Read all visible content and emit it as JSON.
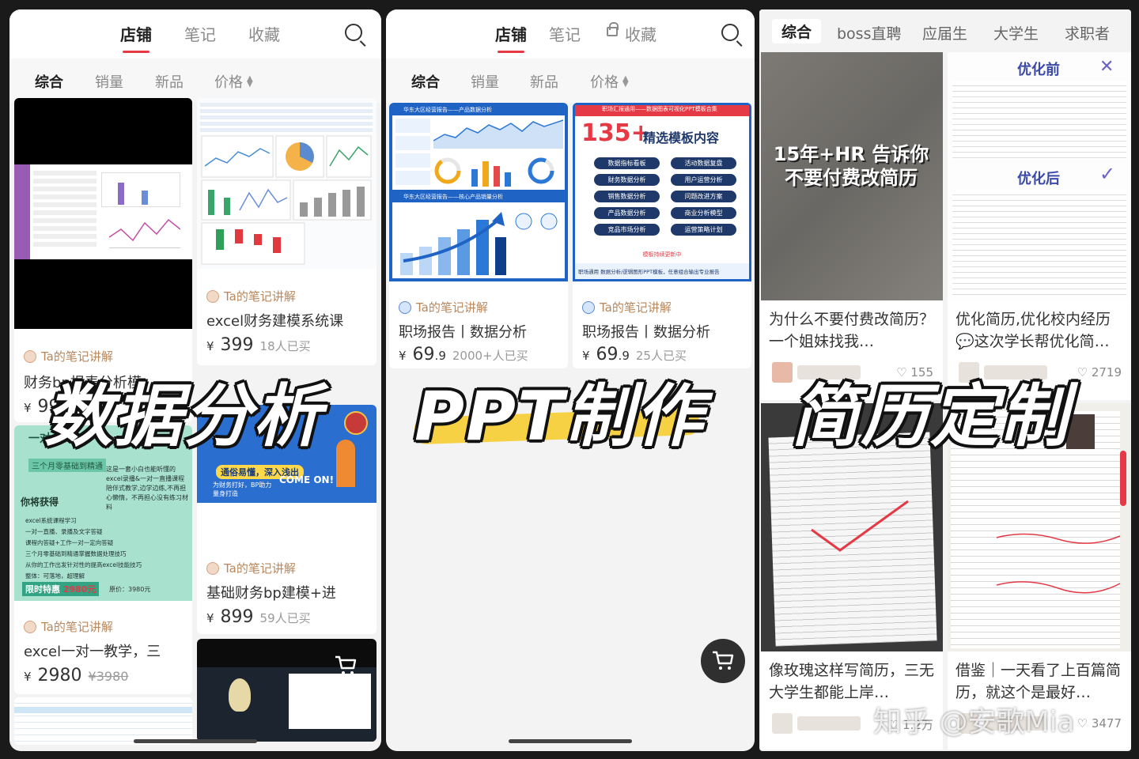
{
  "colors": {
    "accent": "#e53945",
    "shop": "#b9875b",
    "overlay_brush": "#f7cf3a"
  },
  "panel1": {
    "tabs": [
      "店铺",
      "笔记",
      "收藏"
    ],
    "filters": [
      "综合",
      "销量",
      "新品",
      "价格"
    ],
    "cards": [
      {
        "shop": "Ta的笔记讲解",
        "title": "财务bp报表分析模",
        "price": "99",
        "sold": ""
      },
      {
        "shop": "Ta的笔记讲解",
        "title": "excel财务建模系统课",
        "price": "399",
        "sold": "18人已买"
      },
      {
        "shop": "Ta的笔记讲解",
        "title": "excel一对一教学，三",
        "price": "2980",
        "strike": "3980"
      },
      {
        "shop": "Ta的笔记讲解",
        "title": "基础财务bp建模+进",
        "price": "899",
        "sold": "59人已买"
      }
    ],
    "promo": {
      "head": "一对一",
      "sub": "三个月零基础到精通",
      "get": "你将获得",
      "desc": "这是一套小白也能听懂的excel录播&一对一直播课程 陪伴式教学,边学边练,不再担心懒惰，不再担心没有练习材料",
      "items": [
        "excel系统课程学习",
        "一对一直播、录播及文字答疑",
        "课程内答疑+工作一对一定向答疑",
        "三个月零基础到精通掌握数据处理技巧",
        "从你的工作出发针对性的提高excel技能技巧",
        "整体：可落地，超理解"
      ],
      "deal": "限时特惠",
      "deal_price": "2980元",
      "orig": "原价：3980元"
    },
    "course_banner": {
      "line1": "通俗易懂，深入浅出",
      "line2": "COME ON!",
      "line3": "为财务打好，BP助力 量身打造"
    }
  },
  "panel2": {
    "tabs": [
      "店铺",
      "笔记",
      "收藏"
    ],
    "filters": [
      "综合",
      "销量",
      "新品",
      "价格"
    ],
    "cards": [
      {
        "shop": "Ta的笔记讲解",
        "title": "职场报告丨数据分析",
        "price": "69",
        "decimal": ".9",
        "sold": "2000+人已买"
      },
      {
        "shop": "Ta的笔记讲解",
        "title": "职场报告丨数据分析",
        "price": "69",
        "decimal": ".9",
        "sold": "25人已买"
      }
    ],
    "ppt": {
      "top_label": "职场汇报通用——数据图表可视化PPT模板合集",
      "big_number": "135+",
      "big_label": "精选模板内容",
      "buttons": [
        "数据指标看板",
        "活动数据复盘",
        "财务数据分析",
        "用户运营分析",
        "销售数据分析",
        "问题改进方案",
        "产品数据分析",
        "商业分析模型",
        "竞品市场分析",
        "运营策略计划"
      ],
      "more": "模板持续更新中",
      "footer": "职场通用 数据分析/逻辑图形PPT模板，任意组合输出专业报告",
      "dash1": "华东大区经营报告——产品数据分析",
      "dash2": "华东大区经营报告——核心产品销量分析"
    }
  },
  "panel3": {
    "tabs": [
      "综合",
      "boss直聘",
      "应届生",
      "大学生",
      "求职者"
    ],
    "notes": [
      {
        "title": "为什么不要付费改简历？一个姐妹找我…",
        "likes": "155",
        "cover": "15年+HR 告诉你 不要付费改简历"
      },
      {
        "title": "优化简历,优化校内经历 💬这次学长帮优化简…",
        "likes": "2719",
        "before": "优化前",
        "after": "优化后"
      },
      {
        "title": "像玫瑰这样写简历，三无大学生都能上岸…",
        "likes": "1.2万"
      },
      {
        "title": "借鉴｜一天看了上百篇简历，就这个是最好…",
        "likes": "3477"
      }
    ]
  },
  "overlays": [
    "数据分析",
    "PPT制作",
    "简历定制"
  ],
  "watermark": "知乎 @安歌Mia",
  "icons": [
    "search-icon",
    "lock-icon",
    "cart-icon",
    "heart-icon",
    "shop-avatar-icon"
  ]
}
